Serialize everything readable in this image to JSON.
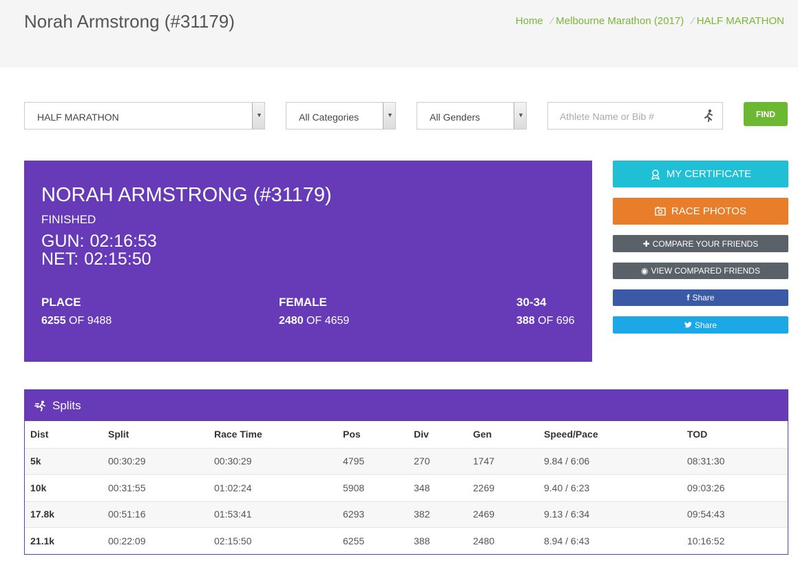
{
  "header": {
    "title": "Norah Armstrong (#31179)",
    "breadcrumbs": [
      "Home",
      "Melbourne Marathon (2017)",
      "HALF MARATHON"
    ]
  },
  "filters": {
    "race": "HALF MARATHON",
    "category": "All Categories",
    "gender": "All Genders",
    "search_placeholder": "Athlete Name or Bib #",
    "find_label": "FIND"
  },
  "athlete": {
    "name": "NORAH ARMSTRONG (#31179)",
    "status": "FINISHED",
    "gun_label": "GUN:",
    "gun_time": "02:16:53",
    "net_label": "NET:",
    "net_time": "02:15:50",
    "stats": [
      {
        "label": "PLACE",
        "pos": "6255",
        "of": "OF",
        "total": "9488"
      },
      {
        "label": "FEMALE",
        "pos": "2480",
        "of": "OF",
        "total": "4659"
      },
      {
        "label": "30-34",
        "pos": "388",
        "of": "OF",
        "total": "696"
      }
    ]
  },
  "actions": {
    "certificate": "MY CERTIFICATE",
    "photos": "RACE PHOTOS",
    "compare": "COMPARE YOUR FRIENDS",
    "view_compared": "VIEW COMPARED FRIENDS",
    "facebook_share": "Share",
    "twitter_share": "Share"
  },
  "colors": {
    "accent_purple": "#673ab7",
    "find_green": "#6cb833",
    "certificate_cyan": "#1fc0d6",
    "photos_orange": "#e87d2a",
    "facebook_blue": "#3b5aa5",
    "twitter_blue": "#1ca7e6"
  },
  "splits": {
    "title": "Splits",
    "columns": [
      "Dist",
      "Split",
      "Race Time",
      "Pos",
      "Div",
      "Gen",
      "Speed/Pace",
      "TOD"
    ],
    "rows": [
      [
        "5k",
        "00:30:29",
        "00:30:29",
        "4795",
        "270",
        "1747",
        "9.84 / 6:06",
        "08:31:30"
      ],
      [
        "10k",
        "00:31:55",
        "01:02:24",
        "5908",
        "348",
        "2269",
        "9.40 / 6:23",
        "09:03:26"
      ],
      [
        "17.8k",
        "00:51:16",
        "01:53:41",
        "6293",
        "382",
        "2469",
        "9.13 / 6:34",
        "09:54:43"
      ],
      [
        "21.1k",
        "00:22:09",
        "02:15:50",
        "6255",
        "388",
        "2480",
        "8.94 / 6:43",
        "10:16:52"
      ]
    ]
  }
}
